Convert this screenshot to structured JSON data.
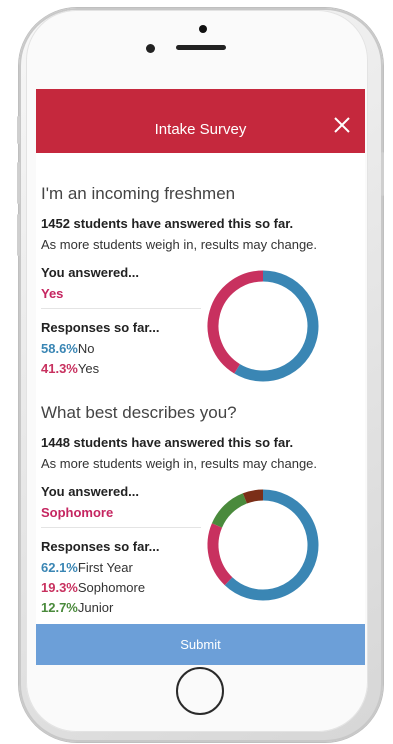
{
  "header": {
    "title": "Intake Survey"
  },
  "questions": [
    {
      "question": "I'm an incoming freshmen",
      "count_text": "1452 students have answered this so far.",
      "note": "As more students weigh in, results may change.",
      "you_answered_label": "You answered...",
      "answer": "Yes",
      "responses_label": "Responses so far...",
      "responses": [
        {
          "pct": "58.6%",
          "label": "No",
          "value": 58.6,
          "color": "#3a86b4"
        },
        {
          "pct": "41.3%",
          "label": "Yes",
          "value": 41.3,
          "color": "#c8315f"
        }
      ]
    },
    {
      "question": "What best describes you?",
      "count_text": "1448 students have answered this so far.",
      "note": "As more students weigh in, results may change.",
      "you_answered_label": "You answered...",
      "answer": "Sophomore",
      "responses_label": "Responses so far...",
      "responses": [
        {
          "pct": "62.1%",
          "label": "First Year",
          "value": 62.1,
          "color": "#3a86b4"
        },
        {
          "pct": "19.3%",
          "label": "Sophomore",
          "value": 19.3,
          "color": "#c8315f"
        },
        {
          "pct": "12.7%",
          "label": "Junior",
          "value": 12.7,
          "color": "#4a8a3c"
        },
        {
          "value": 5.9,
          "color": "#7b2f18"
        }
      ]
    }
  ],
  "submit_label": "Submit",
  "icons": {
    "close": "close-icon"
  },
  "colors": {
    "header": "#c5283d",
    "submit": "#6c9fd8",
    "answer": "#c52560"
  }
}
